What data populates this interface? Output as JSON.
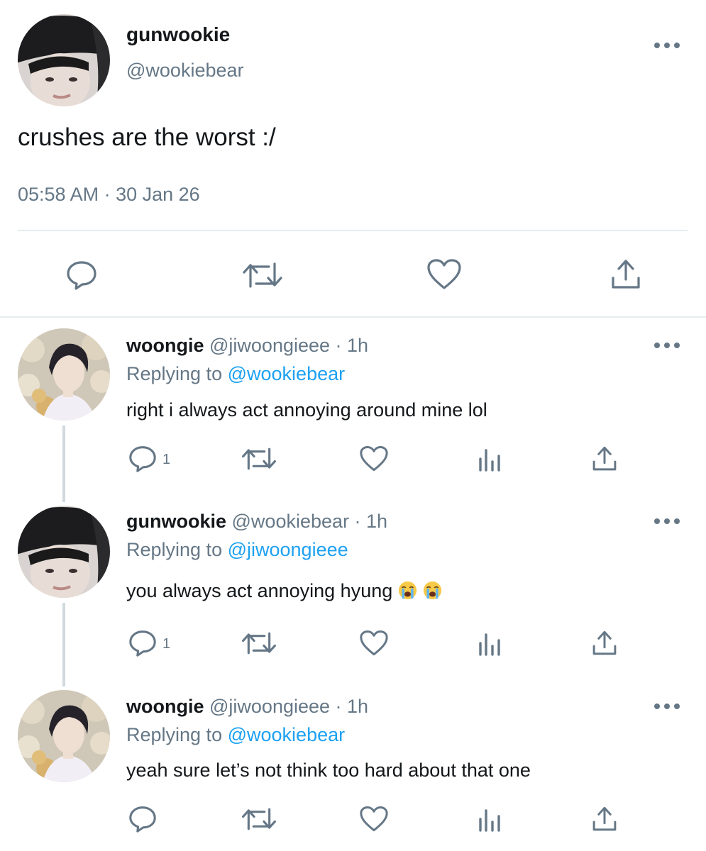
{
  "main_tweet": {
    "display_name": "gunwookie",
    "handle": "@wookiebear",
    "text": "crushes are the worst :/",
    "timestamp": "05:58 AM · 30 Jan 26",
    "actions": [
      "reply-icon",
      "retweet-icon",
      "like-icon",
      "share-icon"
    ]
  },
  "replies": [
    {
      "display_name": "woongie",
      "handle": "@jiwoongieee · 1h",
      "replying_prefix": "Replying to",
      "replying_to": "@wookiebear",
      "text": "right i always act annoying around mine lol",
      "reply_count": "1",
      "emoji_count": 0
    },
    {
      "display_name": "gunwookie",
      "handle": "@wookiebear · 1h",
      "replying_prefix": "Replying to",
      "replying_to": "@jiwoongieee",
      "text": "you always act annoying hyung",
      "reply_count": "1",
      "emoji": [
        "loudly-crying-face-emoji",
        "loudly-crying-face-emoji"
      ]
    },
    {
      "display_name": "woongie",
      "handle": "@jiwoongieee · 1h",
      "replying_prefix": "Replying to",
      "replying_to": "@wookiebear",
      "text": "yeah sure let’s not think too hard about that one",
      "reply_count": "",
      "emoji_count": 0
    }
  ],
  "colors": {
    "text": "#14171a",
    "muted": "#657786",
    "link": "#1da1f2",
    "divider": "#e6ecf0",
    "thread_line": "#cfd9de"
  }
}
